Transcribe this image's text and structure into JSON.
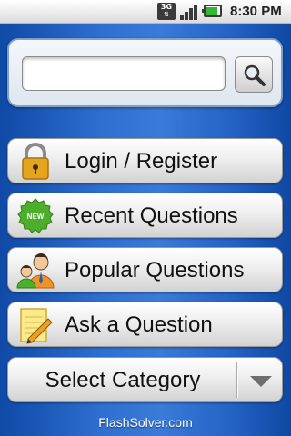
{
  "status_bar": {
    "network_label": "3G",
    "time": "8:30 PM"
  },
  "search": {
    "value": "",
    "placeholder": ""
  },
  "menu": {
    "login_label": "Login / Register",
    "recent_label": "Recent Questions",
    "recent_badge": "NEW",
    "popular_label": "Popular Questions",
    "ask_label": "Ask a Question",
    "category_label": "Select Category"
  },
  "footer": {
    "site": "FlashSolver.com"
  },
  "colors": {
    "background_blue": "#2f6fd0",
    "badge_green": "#4cae2a",
    "lock_gold": "#e2a51d",
    "battery_green": "#36b636"
  },
  "icons": [
    "3g-icon",
    "signal-icon",
    "battery-icon",
    "search-icon",
    "lock-icon",
    "new-badge-icon",
    "users-icon",
    "notepad-icon",
    "dropdown-arrow-icon"
  ]
}
